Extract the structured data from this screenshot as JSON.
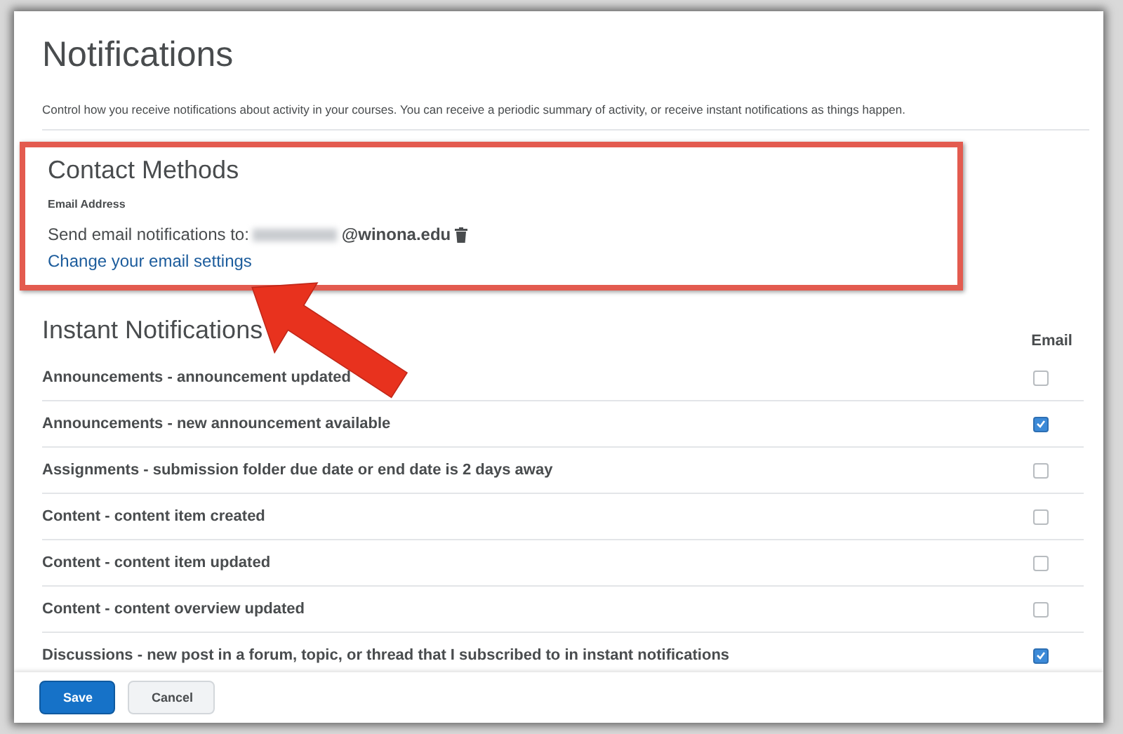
{
  "page": {
    "title": "Notifications",
    "description": "Control how you receive notifications about activity in your courses. You can receive a periodic summary of activity, or receive instant notifications as things happen."
  },
  "contact_methods": {
    "title": "Contact Methods",
    "label": "Email Address",
    "send_text": "Send email notifications to:",
    "email_domain": "@winona.edu",
    "change_link": "Change your email settings"
  },
  "instant_notifications": {
    "title": "Instant Notifications",
    "column": "Email",
    "rows": [
      {
        "label": "Announcements - announcement updated",
        "checked": false
      },
      {
        "label": "Announcements - new announcement available",
        "checked": true
      },
      {
        "label": "Assignments - submission folder due date or end date is 2 days away",
        "checked": false
      },
      {
        "label": "Content - content item created",
        "checked": false
      },
      {
        "label": "Content - content item updated",
        "checked": false
      },
      {
        "label": "Content - content overview updated",
        "checked": false
      },
      {
        "label": "Discussions - new post in a forum, topic, or thread that I subscribed to in instant notifications",
        "checked": true
      }
    ]
  },
  "footer": {
    "buttons": [
      {
        "label": "Save",
        "kind": "primary"
      },
      {
        "label": "Cancel",
        "kind": "secondary"
      }
    ]
  }
}
